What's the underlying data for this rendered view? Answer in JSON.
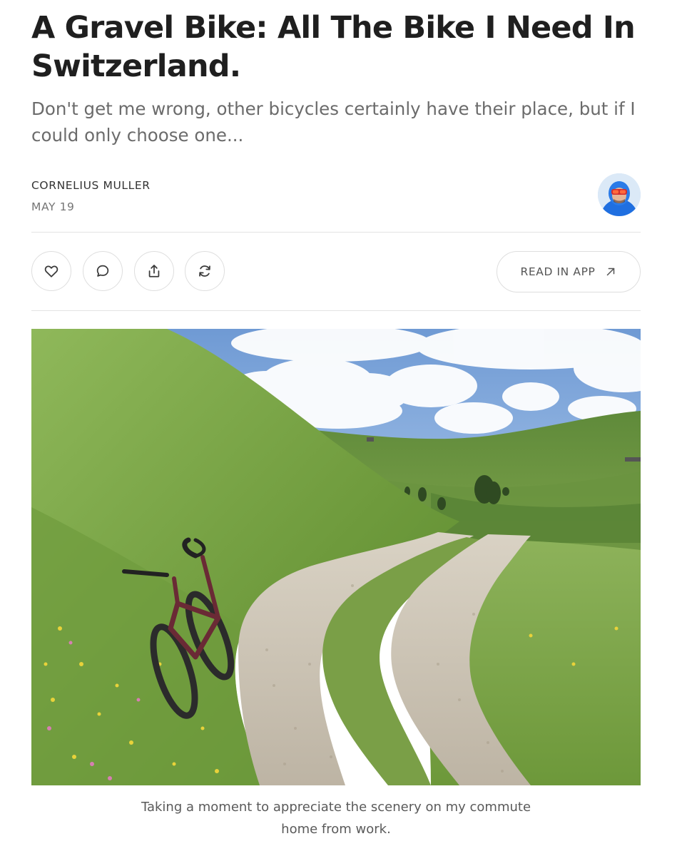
{
  "article": {
    "title": "A Gravel Bike: All The Bike I Need In Switzerland.",
    "subtitle": "Don't get me wrong, other bicycles certainly have their place, but if I could only choose one...",
    "author": "CORNELIUS MULLER",
    "date": "MAY 19"
  },
  "actions": {
    "like_icon": "heart-icon",
    "comment_icon": "comment-icon",
    "share_icon": "share-icon",
    "restack_icon": "restack-icon",
    "read_in_app_label": "READ IN APP",
    "read_in_app_icon": "arrow-up-right-icon"
  },
  "image": {
    "caption": "Taking a moment to appreciate the scenery on my commute home from work."
  },
  "colors": {
    "title": "#1f1f1f",
    "subtitle": "#6b6b6b",
    "border": "#dedede",
    "caption": "#5a5a5a"
  }
}
